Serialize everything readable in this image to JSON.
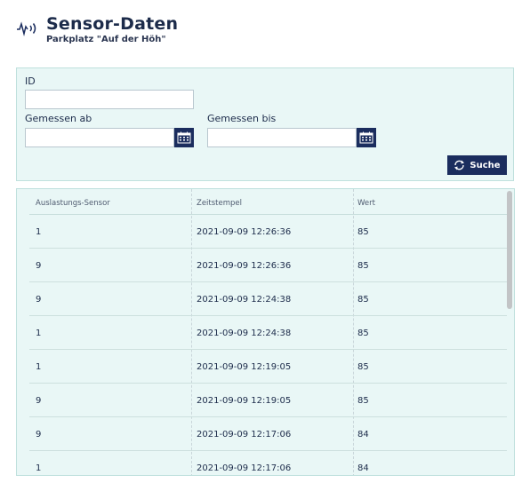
{
  "header": {
    "icon": "sensor-signal-icon",
    "title": "Sensor-Daten",
    "subtitle": "Parkplatz \"Auf der Höh\""
  },
  "filter": {
    "id_label": "ID",
    "id_value": "",
    "from_label": "Gemessen ab",
    "from_value": "",
    "to_label": "Gemessen bis",
    "to_value": "",
    "calendar_icon": "calendar-icon",
    "search_label": "Suche",
    "search_icon": "refresh-icon"
  },
  "table": {
    "columns": [
      "Auslastungs-Sensor",
      "Zeitstempel",
      "Wert"
    ],
    "rows": [
      {
        "sensor": "1",
        "timestamp": "2021-09-09 12:26:36",
        "value": "85"
      },
      {
        "sensor": "9",
        "timestamp": "2021-09-09 12:26:36",
        "value": "85"
      },
      {
        "sensor": "9",
        "timestamp": "2021-09-09 12:24:38",
        "value": "85"
      },
      {
        "sensor": "1",
        "timestamp": "2021-09-09 12:24:38",
        "value": "85"
      },
      {
        "sensor": "1",
        "timestamp": "2021-09-09 12:19:05",
        "value": "85"
      },
      {
        "sensor": "9",
        "timestamp": "2021-09-09 12:19:05",
        "value": "85"
      },
      {
        "sensor": "9",
        "timestamp": "2021-09-09 12:17:06",
        "value": "84"
      },
      {
        "sensor": "1",
        "timestamp": "2021-09-09 12:17:06",
        "value": "84"
      }
    ]
  },
  "colors": {
    "primary": "#1b2d5e",
    "panel_bg": "#e9f7f6",
    "text": "#1c2b4a"
  }
}
